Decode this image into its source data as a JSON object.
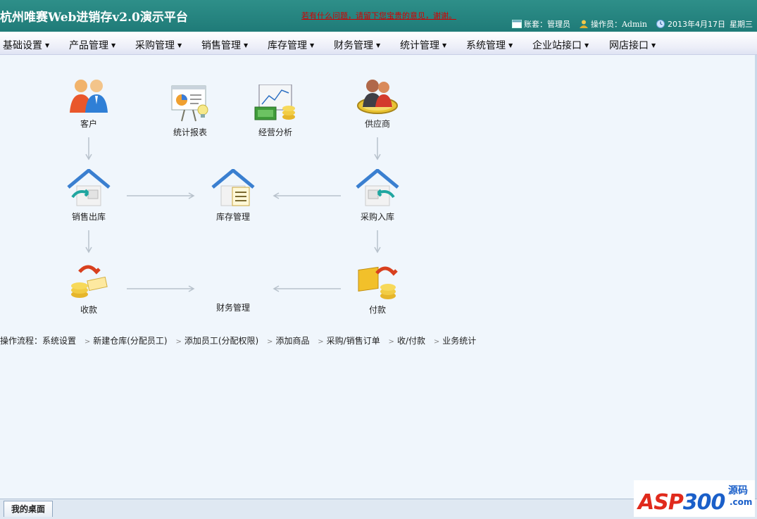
{
  "header": {
    "app_title": "杭州唯赛Web进销存v2.0演示平台",
    "notice": "若有什么问题，请留下您宝贵的意见，谢谢。",
    "account_label": "账套：",
    "account_value": "管理员",
    "operator_label": "操作员：",
    "operator_value": "Admin",
    "date": "2013年4月17日",
    "weekday": "星期三",
    "colors": {
      "header_bg": "#2e8f89",
      "notice": "#d40000"
    }
  },
  "menu": {
    "items": [
      {
        "label": "基础设置"
      },
      {
        "label": "产品管理"
      },
      {
        "label": "采购管理"
      },
      {
        "label": "销售管理"
      },
      {
        "label": "库存管理"
      },
      {
        "label": "财务管理"
      },
      {
        "label": "统计管理"
      },
      {
        "label": "系统管理"
      },
      {
        "label": "企业站接口"
      },
      {
        "label": "网店接口"
      }
    ]
  },
  "desktop": {
    "nodes": {
      "customer": {
        "label": "客户",
        "icon": "customer-group-icon"
      },
      "report": {
        "label": "统计报表",
        "icon": "report-board-icon"
      },
      "analysis": {
        "label": "经营分析",
        "icon": "business-analysis-icon"
      },
      "supplier": {
        "label": "供应商",
        "icon": "supplier-icon"
      },
      "sales_out": {
        "label": "销售出库",
        "icon": "warehouse-out-icon"
      },
      "inventory": {
        "label": "库存管理",
        "icon": "warehouse-document-icon"
      },
      "purchase_in": {
        "label": "采购入库",
        "icon": "warehouse-in-icon"
      },
      "receipt": {
        "label": "收款",
        "icon": "money-receive-icon"
      },
      "finance": {
        "label": "财务管理",
        "icon": ""
      },
      "payment": {
        "label": "付款",
        "icon": "money-pay-icon"
      }
    },
    "flow": {
      "prefix": "操作流程：",
      "steps": [
        "系统设置",
        "新建仓库(分配员工)",
        "添加员工(分配权限)",
        "添加商品",
        "采购/销售订单",
        "收/付款",
        "业务统计"
      ]
    }
  },
  "footer": {
    "tab_label": "我的桌面"
  },
  "watermark": {
    "brand": "ASP300",
    "ym": "源码",
    "com": ".com"
  }
}
